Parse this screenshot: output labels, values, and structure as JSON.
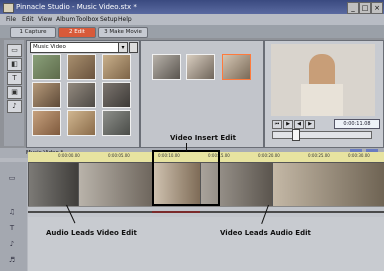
{
  "window": {
    "title": "Pinnacle Studio - Music Video.stx *"
  },
  "menu": [
    "File",
    "Edit",
    "View",
    "Album",
    "Toolbox",
    "Setup",
    "Help"
  ],
  "steps": [
    "1 Capture",
    "2 Edit",
    "3 Make Movie"
  ],
  "album": {
    "selected": "Music Video"
  },
  "player": {
    "timecode": "0:00:11.08"
  },
  "timeline": {
    "title": "Music Video *",
    "ticks": [
      "0:00:00.00",
      "0:00:05.00",
      "0:00:10.00",
      "0:00:15.00",
      "0:00:20.00",
      "0:00:25.00",
      "0:00:30.00"
    ]
  },
  "annotations": {
    "insert": "Video Insert Edit",
    "audio_leads": "Audio Leads Video Edit",
    "video_leads": "Video Leads Audio Edit"
  },
  "colors": {
    "accent": "#d85a3a",
    "ruler": "#e7e3a0"
  }
}
